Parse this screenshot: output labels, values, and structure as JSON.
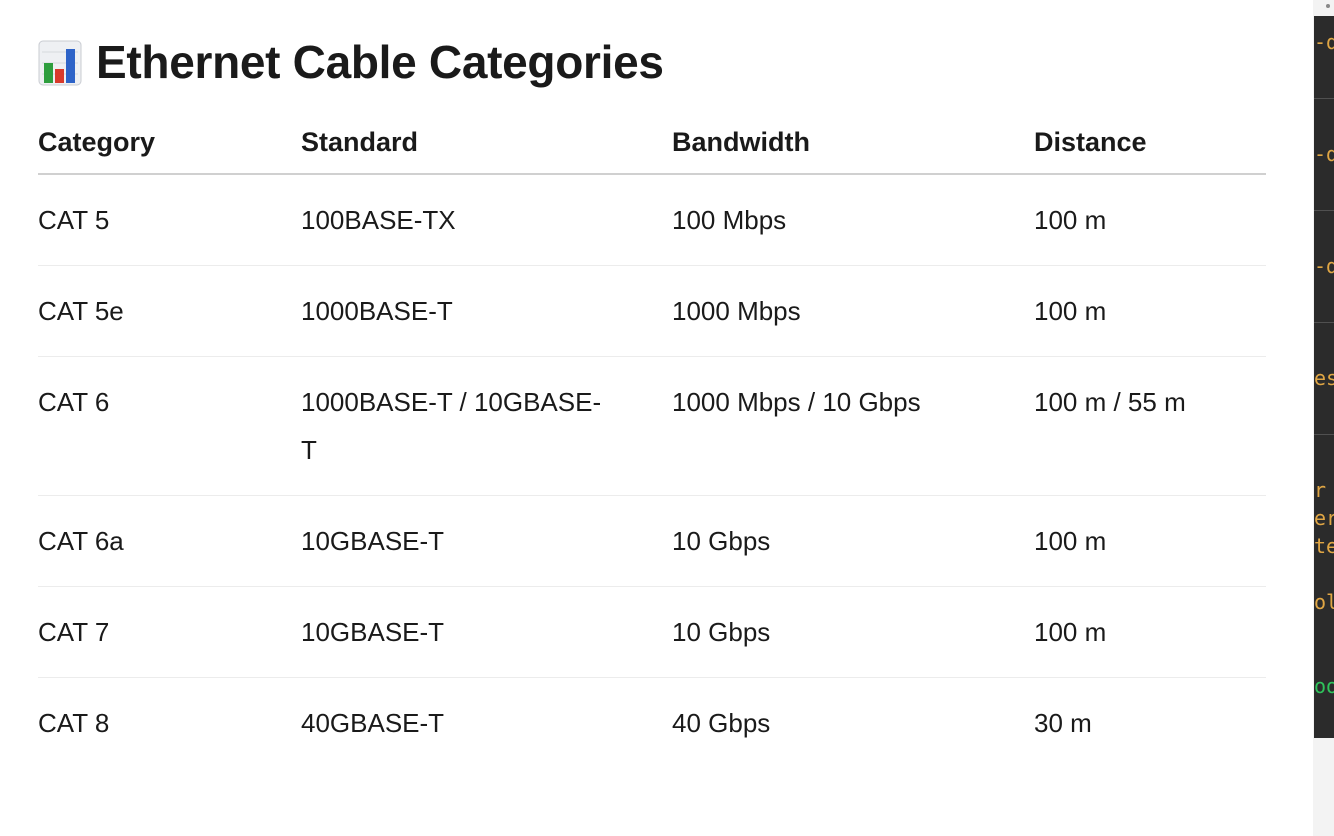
{
  "page": {
    "title": "Ethernet Cable Categories",
    "title_icon": "bar-chart-icon"
  },
  "table": {
    "headers": [
      "Category",
      "Standard",
      "Bandwidth",
      "Distance"
    ],
    "rows": [
      [
        "CAT 5",
        "100BASE-TX",
        "100 Mbps",
        "100 m"
      ],
      [
        "CAT 5e",
        "1000BASE-T",
        "1000 Mbps",
        "100 m"
      ],
      [
        "CAT 6",
        "1000BASE-T / 10GBASE-T",
        "1000 Mbps / 10 Gbps",
        "100 m / 55 m"
      ],
      [
        "CAT 6a",
        "10GBASE-T",
        "10 Gbps",
        "100 m"
      ],
      [
        "CAT 7",
        "10GBASE-T",
        "10 Gbps",
        "100 m"
      ],
      [
        "CAT 8",
        "40GBASE-T",
        "40 Gbps",
        "30 m"
      ]
    ]
  },
  "side_panel": {
    "fragments": [
      "-d",
      "-d",
      "-d",
      "es",
      "r",
      "er",
      "te",
      "ol",
      "oo"
    ]
  },
  "colors": {
    "text": "#1a1a1a",
    "header_rule": "#d0d0d0",
    "row_rule": "#ececec",
    "editor_bg": "#2b2b2b",
    "editor_orange": "#e0a644",
    "editor_green": "#2fc25b"
  }
}
